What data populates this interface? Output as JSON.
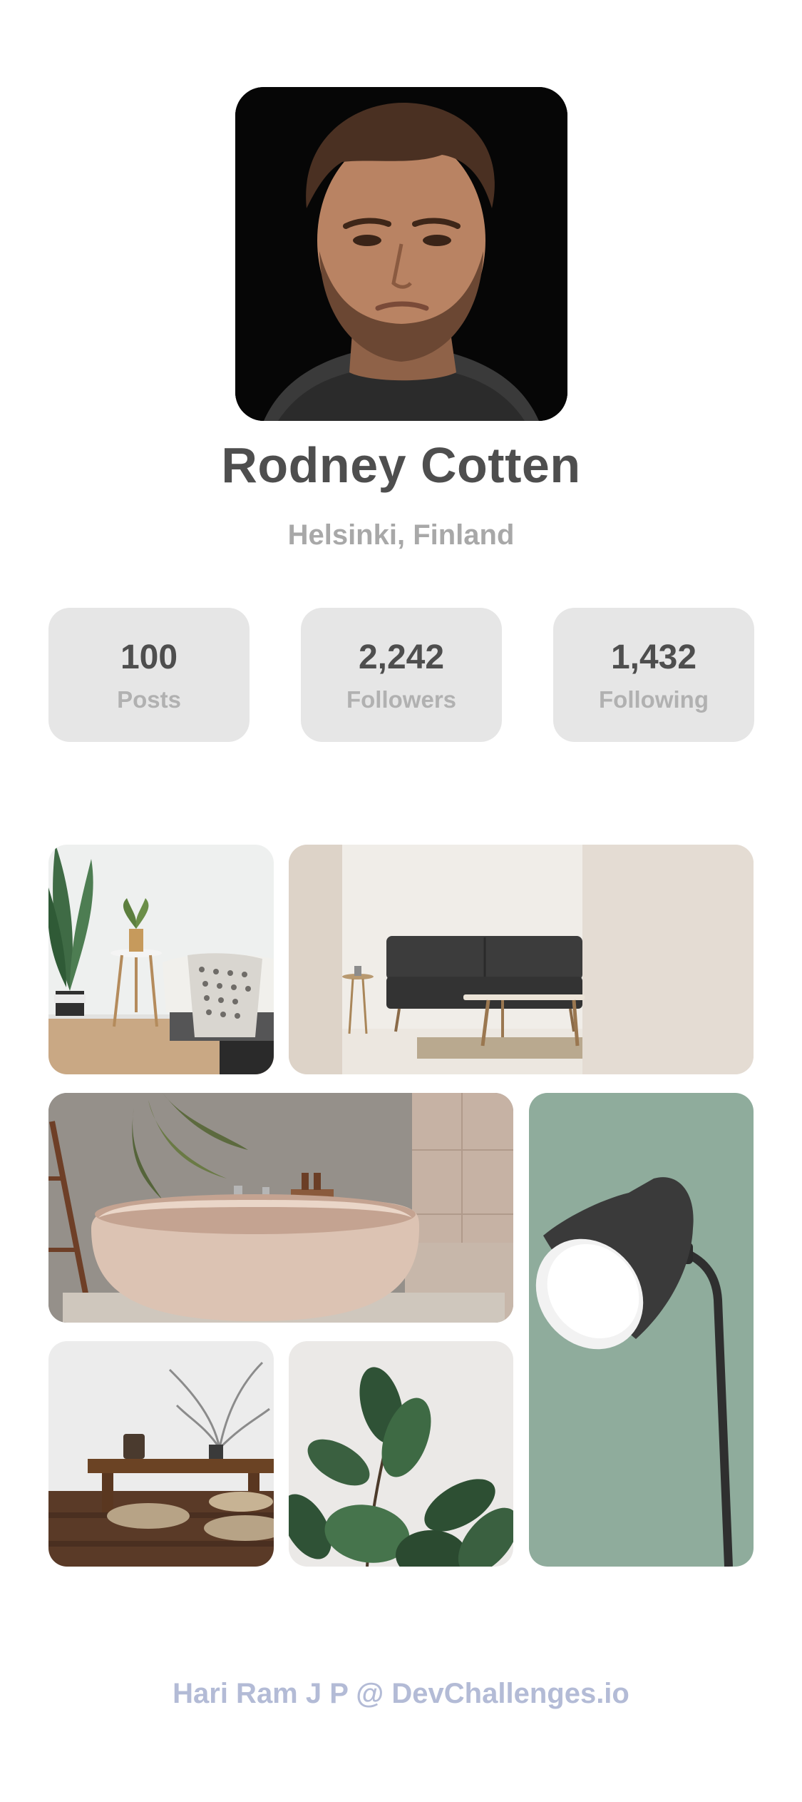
{
  "profile": {
    "name": "Rodney Cotten",
    "location": "Helsinki, Finland"
  },
  "stats": [
    {
      "value": "100",
      "label": "Posts"
    },
    {
      "value": "2,242",
      "label": "Followers"
    },
    {
      "value": "1,432",
      "label": "Following"
    }
  ],
  "gallery": [
    {
      "subject": "bedroom with plant and side table"
    },
    {
      "subject": "living room with dark sofa"
    },
    {
      "subject": "bathroom with freestanding bathtub"
    },
    {
      "subject": "green wall with black floor lamp"
    },
    {
      "subject": "room with low bench and floor cushions"
    },
    {
      "subject": "rubber plant leaves"
    }
  ],
  "footer": {
    "credit": "Hari Ram J P @ DevChallenges.io"
  },
  "colors": {
    "stat_card_bg": "#e6e6e6",
    "name_text": "#4e4e4e",
    "secondary_text": "#a8a8a8",
    "footer_text": "#b3bbd6"
  }
}
